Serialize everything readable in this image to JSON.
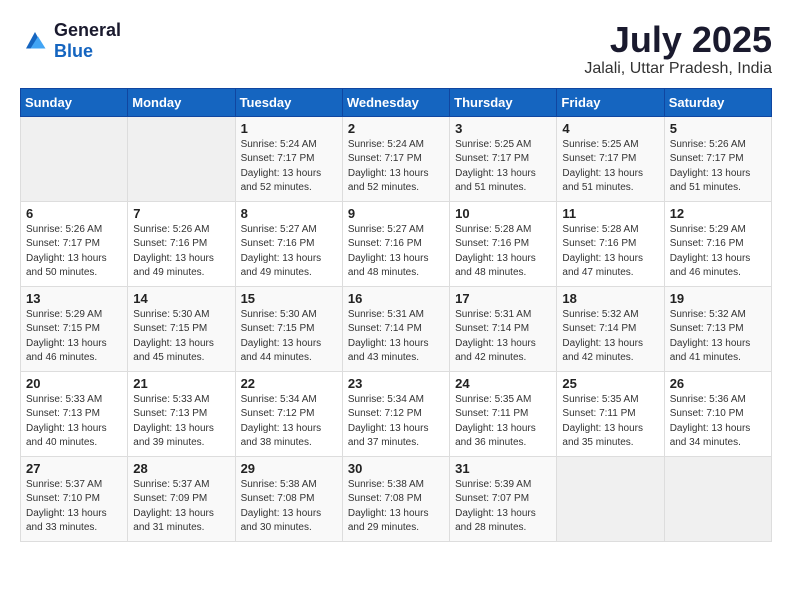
{
  "logo": {
    "general": "General",
    "blue": "Blue"
  },
  "title": {
    "month": "July 2025",
    "location": "Jalali, Uttar Pradesh, India"
  },
  "weekdays": [
    "Sunday",
    "Monday",
    "Tuesday",
    "Wednesday",
    "Thursday",
    "Friday",
    "Saturday"
  ],
  "weeks": [
    [
      {
        "day": null
      },
      {
        "day": null
      },
      {
        "day": "1",
        "sunrise": "Sunrise: 5:24 AM",
        "sunset": "Sunset: 7:17 PM",
        "daylight": "Daylight: 13 hours and 52 minutes."
      },
      {
        "day": "2",
        "sunrise": "Sunrise: 5:24 AM",
        "sunset": "Sunset: 7:17 PM",
        "daylight": "Daylight: 13 hours and 52 minutes."
      },
      {
        "day": "3",
        "sunrise": "Sunrise: 5:25 AM",
        "sunset": "Sunset: 7:17 PM",
        "daylight": "Daylight: 13 hours and 51 minutes."
      },
      {
        "day": "4",
        "sunrise": "Sunrise: 5:25 AM",
        "sunset": "Sunset: 7:17 PM",
        "daylight": "Daylight: 13 hours and 51 minutes."
      },
      {
        "day": "5",
        "sunrise": "Sunrise: 5:26 AM",
        "sunset": "Sunset: 7:17 PM",
        "daylight": "Daylight: 13 hours and 51 minutes."
      }
    ],
    [
      {
        "day": "6",
        "sunrise": "Sunrise: 5:26 AM",
        "sunset": "Sunset: 7:17 PM",
        "daylight": "Daylight: 13 hours and 50 minutes."
      },
      {
        "day": "7",
        "sunrise": "Sunrise: 5:26 AM",
        "sunset": "Sunset: 7:16 PM",
        "daylight": "Daylight: 13 hours and 49 minutes."
      },
      {
        "day": "8",
        "sunrise": "Sunrise: 5:27 AM",
        "sunset": "Sunset: 7:16 PM",
        "daylight": "Daylight: 13 hours and 49 minutes."
      },
      {
        "day": "9",
        "sunrise": "Sunrise: 5:27 AM",
        "sunset": "Sunset: 7:16 PM",
        "daylight": "Daylight: 13 hours and 48 minutes."
      },
      {
        "day": "10",
        "sunrise": "Sunrise: 5:28 AM",
        "sunset": "Sunset: 7:16 PM",
        "daylight": "Daylight: 13 hours and 48 minutes."
      },
      {
        "day": "11",
        "sunrise": "Sunrise: 5:28 AM",
        "sunset": "Sunset: 7:16 PM",
        "daylight": "Daylight: 13 hours and 47 minutes."
      },
      {
        "day": "12",
        "sunrise": "Sunrise: 5:29 AM",
        "sunset": "Sunset: 7:16 PM",
        "daylight": "Daylight: 13 hours and 46 minutes."
      }
    ],
    [
      {
        "day": "13",
        "sunrise": "Sunrise: 5:29 AM",
        "sunset": "Sunset: 7:15 PM",
        "daylight": "Daylight: 13 hours and 46 minutes."
      },
      {
        "day": "14",
        "sunrise": "Sunrise: 5:30 AM",
        "sunset": "Sunset: 7:15 PM",
        "daylight": "Daylight: 13 hours and 45 minutes."
      },
      {
        "day": "15",
        "sunrise": "Sunrise: 5:30 AM",
        "sunset": "Sunset: 7:15 PM",
        "daylight": "Daylight: 13 hours and 44 minutes."
      },
      {
        "day": "16",
        "sunrise": "Sunrise: 5:31 AM",
        "sunset": "Sunset: 7:14 PM",
        "daylight": "Daylight: 13 hours and 43 minutes."
      },
      {
        "day": "17",
        "sunrise": "Sunrise: 5:31 AM",
        "sunset": "Sunset: 7:14 PM",
        "daylight": "Daylight: 13 hours and 42 minutes."
      },
      {
        "day": "18",
        "sunrise": "Sunrise: 5:32 AM",
        "sunset": "Sunset: 7:14 PM",
        "daylight": "Daylight: 13 hours and 42 minutes."
      },
      {
        "day": "19",
        "sunrise": "Sunrise: 5:32 AM",
        "sunset": "Sunset: 7:13 PM",
        "daylight": "Daylight: 13 hours and 41 minutes."
      }
    ],
    [
      {
        "day": "20",
        "sunrise": "Sunrise: 5:33 AM",
        "sunset": "Sunset: 7:13 PM",
        "daylight": "Daylight: 13 hours and 40 minutes."
      },
      {
        "day": "21",
        "sunrise": "Sunrise: 5:33 AM",
        "sunset": "Sunset: 7:13 PM",
        "daylight": "Daylight: 13 hours and 39 minutes."
      },
      {
        "day": "22",
        "sunrise": "Sunrise: 5:34 AM",
        "sunset": "Sunset: 7:12 PM",
        "daylight": "Daylight: 13 hours and 38 minutes."
      },
      {
        "day": "23",
        "sunrise": "Sunrise: 5:34 AM",
        "sunset": "Sunset: 7:12 PM",
        "daylight": "Daylight: 13 hours and 37 minutes."
      },
      {
        "day": "24",
        "sunrise": "Sunrise: 5:35 AM",
        "sunset": "Sunset: 7:11 PM",
        "daylight": "Daylight: 13 hours and 36 minutes."
      },
      {
        "day": "25",
        "sunrise": "Sunrise: 5:35 AM",
        "sunset": "Sunset: 7:11 PM",
        "daylight": "Daylight: 13 hours and 35 minutes."
      },
      {
        "day": "26",
        "sunrise": "Sunrise: 5:36 AM",
        "sunset": "Sunset: 7:10 PM",
        "daylight": "Daylight: 13 hours and 34 minutes."
      }
    ],
    [
      {
        "day": "27",
        "sunrise": "Sunrise: 5:37 AM",
        "sunset": "Sunset: 7:10 PM",
        "daylight": "Daylight: 13 hours and 33 minutes."
      },
      {
        "day": "28",
        "sunrise": "Sunrise: 5:37 AM",
        "sunset": "Sunset: 7:09 PM",
        "daylight": "Daylight: 13 hours and 31 minutes."
      },
      {
        "day": "29",
        "sunrise": "Sunrise: 5:38 AM",
        "sunset": "Sunset: 7:08 PM",
        "daylight": "Daylight: 13 hours and 30 minutes."
      },
      {
        "day": "30",
        "sunrise": "Sunrise: 5:38 AM",
        "sunset": "Sunset: 7:08 PM",
        "daylight": "Daylight: 13 hours and 29 minutes."
      },
      {
        "day": "31",
        "sunrise": "Sunrise: 5:39 AM",
        "sunset": "Sunset: 7:07 PM",
        "daylight": "Daylight: 13 hours and 28 minutes."
      },
      {
        "day": null
      },
      {
        "day": null
      }
    ]
  ]
}
